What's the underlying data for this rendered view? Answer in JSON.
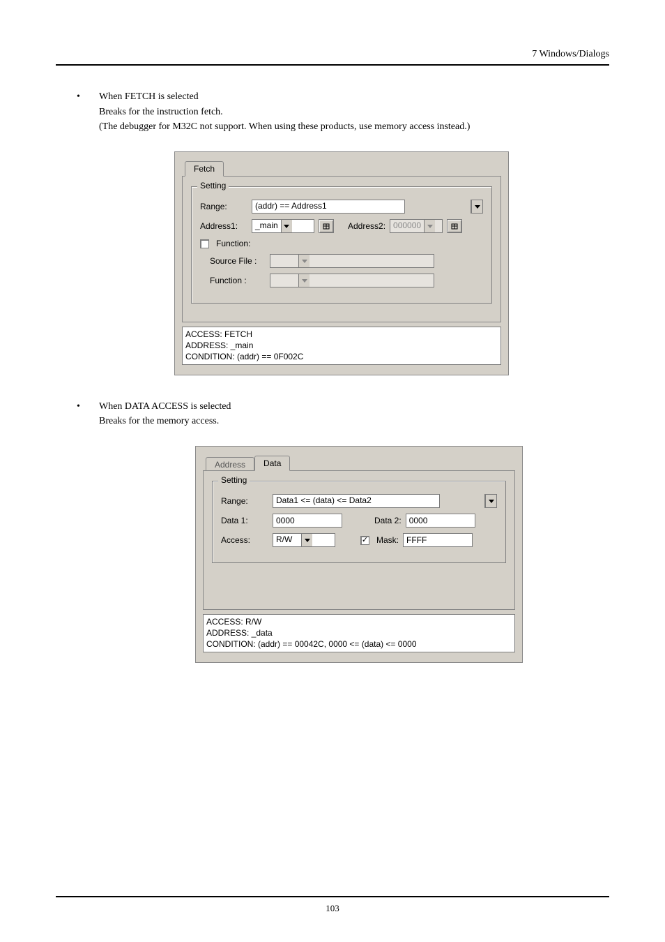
{
  "header": {
    "section": "7  Windows/Dialogs"
  },
  "bullet1": {
    "title": "When FETCH is selected",
    "line1": "Breaks for the instruction fetch.",
    "line2": "(The debugger for M32C not support. When using these products, use memory access instead.)"
  },
  "dialog1": {
    "tabs": {
      "fetch": "Fetch"
    },
    "group": "Setting",
    "range_label": "Range:",
    "range_value": "(addr) == Address1",
    "addr1_label": "Address1:",
    "addr1_value": "_main",
    "addr2_label": "Address2:",
    "addr2_value": "000000",
    "func_check": "Function:",
    "srcfile_label": "Source File :",
    "function_label": "Function :",
    "status": "ACCESS: FETCH\nADDRESS: _main\nCONDITION: (addr) == 0F002C"
  },
  "bullet2": {
    "title": "When DATA ACCESS is selected",
    "line1": "Breaks for the memory access."
  },
  "dialog2": {
    "tabs": {
      "address": "Address",
      "data": "Data"
    },
    "group": "Setting",
    "range_label": "Range:",
    "range_value": "Data1 <= (data) <= Data2",
    "data1_label": "Data 1:",
    "data1_value": "0000",
    "data2_label": "Data 2:",
    "data2_value": "0000",
    "access_label": "Access:",
    "access_value": "R/W",
    "mask_label": "Mask:",
    "mask_value": "FFFF",
    "status": "ACCESS: R/W\nADDRESS: _data\nCONDITION: (addr) == 00042C, 0000 <= (data) <= 0000"
  },
  "footer": {
    "page": "103"
  }
}
